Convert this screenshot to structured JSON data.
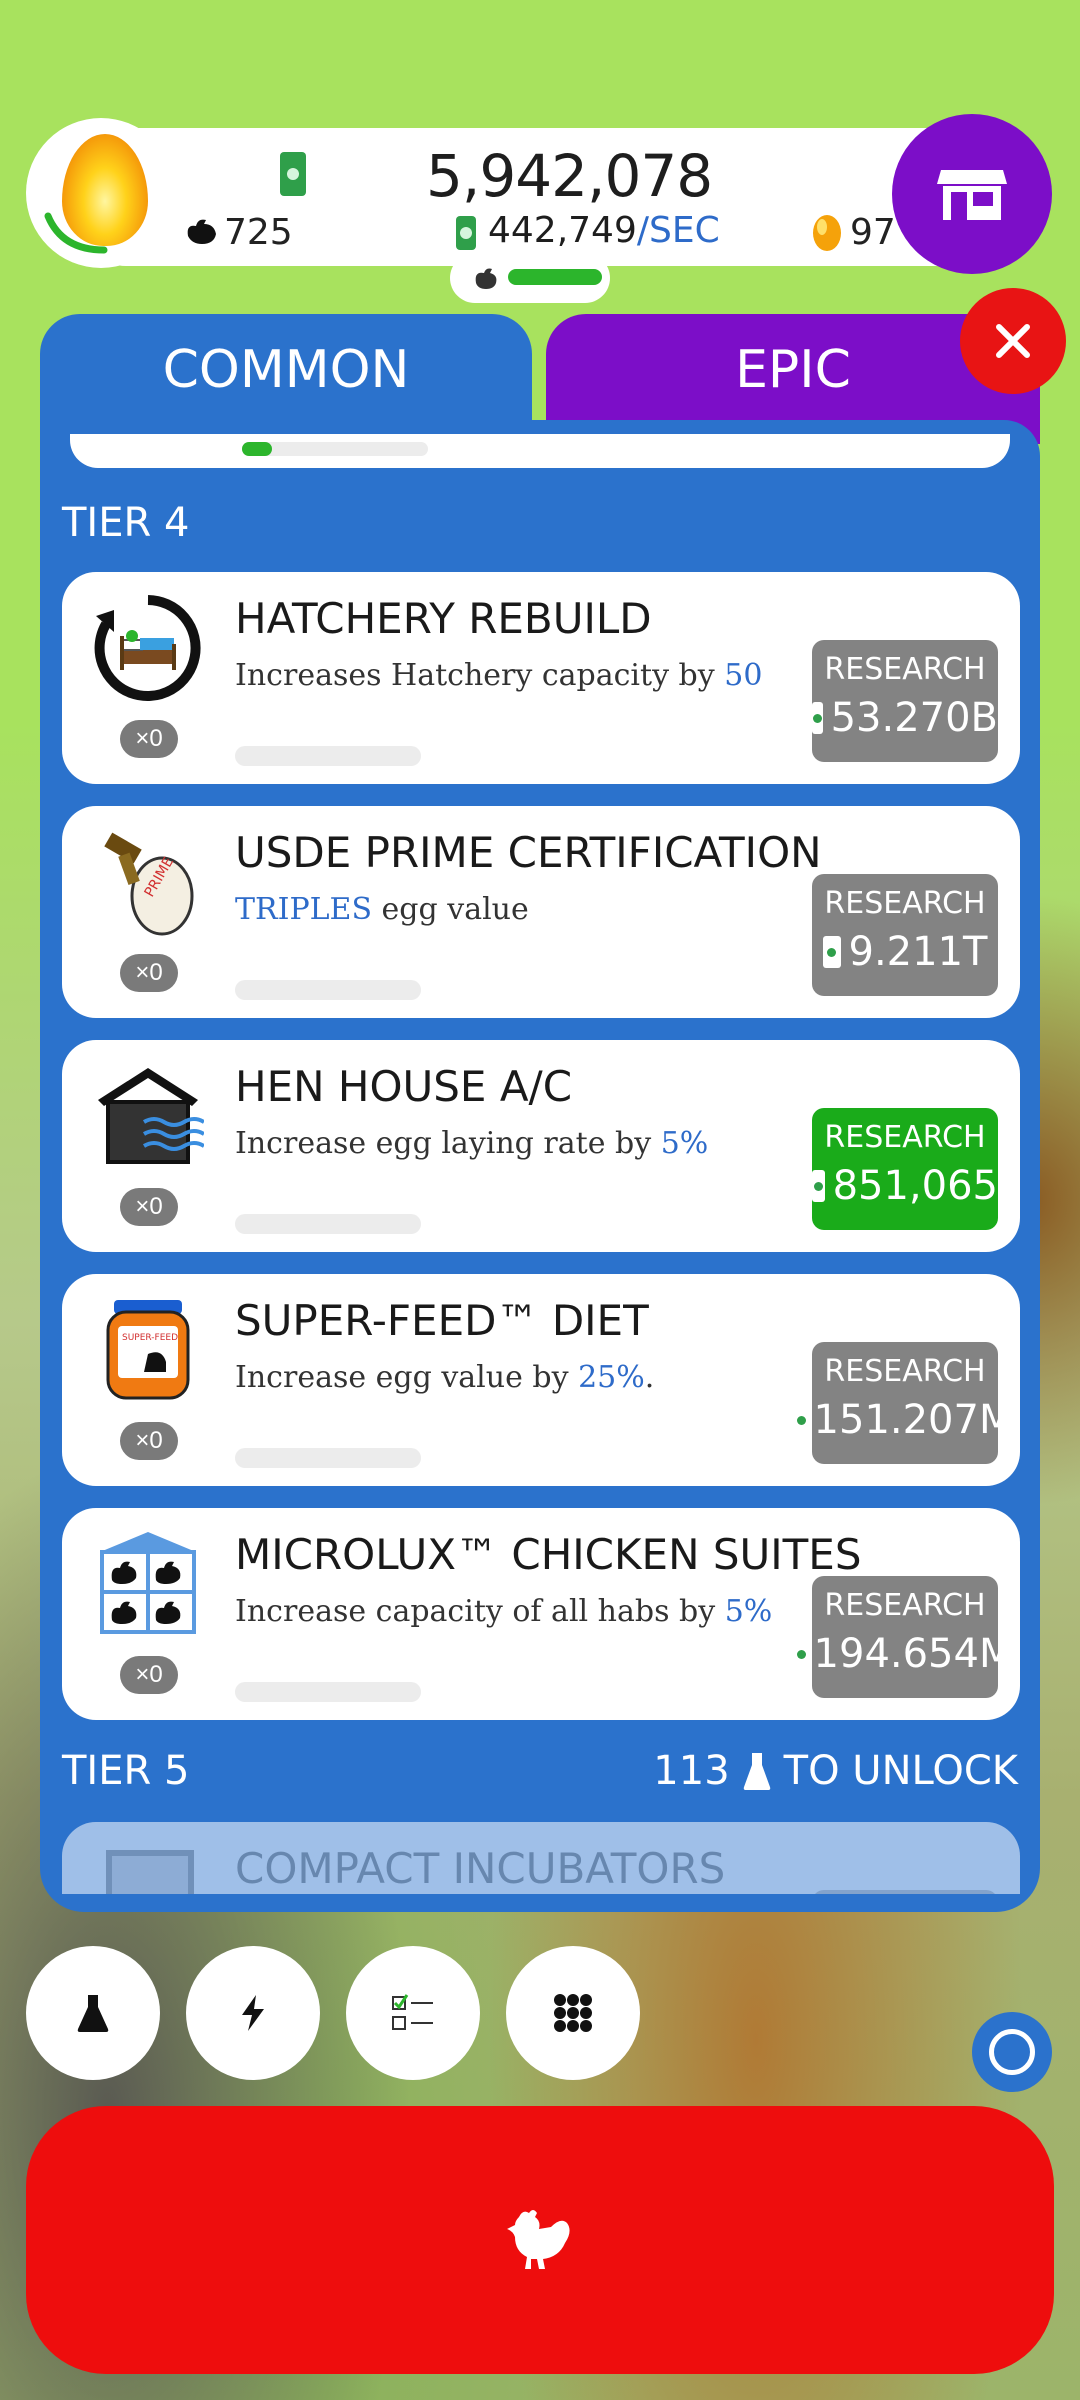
{
  "header": {
    "money": "5,942,078",
    "money_rate": "442,749",
    "money_rate_unit": "/SEC",
    "chicken_count": "725",
    "golden_eggs": "97"
  },
  "tabs": [
    {
      "label": "COMMON"
    },
    {
      "label": "EPIC"
    }
  ],
  "tier4": {
    "label": "TIER 4"
  },
  "research_items": [
    {
      "title": "HATCHERY REBUILD",
      "desc_pre": "Increases Hatchery capacity by ",
      "desc_hl": "50",
      "desc_post": "",
      "count": "×0",
      "button_label": "RESEARCH",
      "cost": "53.270B",
      "icon": "hatchery-rebuild-icon"
    },
    {
      "title": "USDE PRIME CERTIFICATION",
      "desc_pre": "",
      "desc_hl": "TRIPLES",
      "desc_post": " egg value",
      "count": "×0",
      "button_label": "RESEARCH",
      "cost": "9.211T",
      "icon": "prime-stamp-egg-icon"
    },
    {
      "title": "HEN HOUSE A/C",
      "desc_pre": "Increase egg laying rate by ",
      "desc_hl": "5%",
      "desc_post": "",
      "count": "×0",
      "button_label": "RESEARCH",
      "cost": "851,065",
      "icon": "hen-house-ac-icon"
    },
    {
      "title": "SUPER-FEED™ DIET",
      "desc_pre": "Increase egg value by ",
      "desc_hl": "25%",
      "desc_post": ".",
      "count": "×0",
      "button_label": "RESEARCH",
      "cost": "151.207M",
      "icon": "super-feed-jar-icon"
    },
    {
      "title": "MICROLUX™ CHICKEN SUITES",
      "desc_pre": "Increase capacity of all habs by ",
      "desc_hl": "5%",
      "desc_post": "",
      "count": "×0",
      "button_label": "RESEARCH",
      "cost": "194.654M",
      "icon": "chicken-suites-icon"
    }
  ],
  "tier5": {
    "label": "TIER 5",
    "unlock_count": "113",
    "unlock_text": "TO UNLOCK"
  },
  "tier5_first": {
    "title": "COMPACT INCUBATORS"
  },
  "colors": {
    "panel_blue": "#2b72cc",
    "epic_purple": "#7c0ec8",
    "research_green": "#1aab1a",
    "research_grey": "#838383",
    "hatch_red": "#ee0d0d",
    "close_red": "#e81414"
  }
}
